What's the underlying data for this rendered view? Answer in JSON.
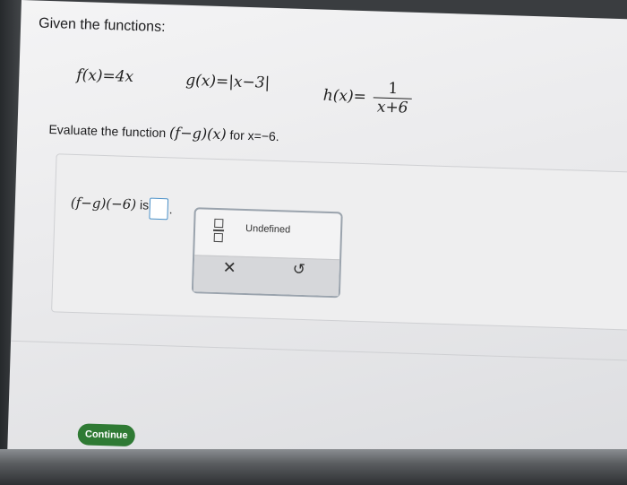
{
  "prompt": {
    "title": "Given the functions:",
    "f_def": "f(x)=4x",
    "g_def": "g(x)=|x−3|",
    "h_lhs": "h(x)=",
    "h_numerator": "1",
    "h_denominator": "x+6",
    "evaluate_prefix": "Evaluate the function",
    "evaluate_expr": "(f−g)(x)",
    "evaluate_suffix": "for x=−6."
  },
  "answer": {
    "label_expr": "(f−g)(−6)",
    "label_is": "is",
    "value": "",
    "trailing": "."
  },
  "palette": {
    "undefined_label": "Undefined",
    "clear_symbol": "✕",
    "undo_symbol": "↺"
  },
  "footer": {
    "continue_label": "Continue",
    "accent": "#2f7a34"
  },
  "icons": [
    "fraction-icon",
    "clear-icon",
    "undo-icon"
  ]
}
